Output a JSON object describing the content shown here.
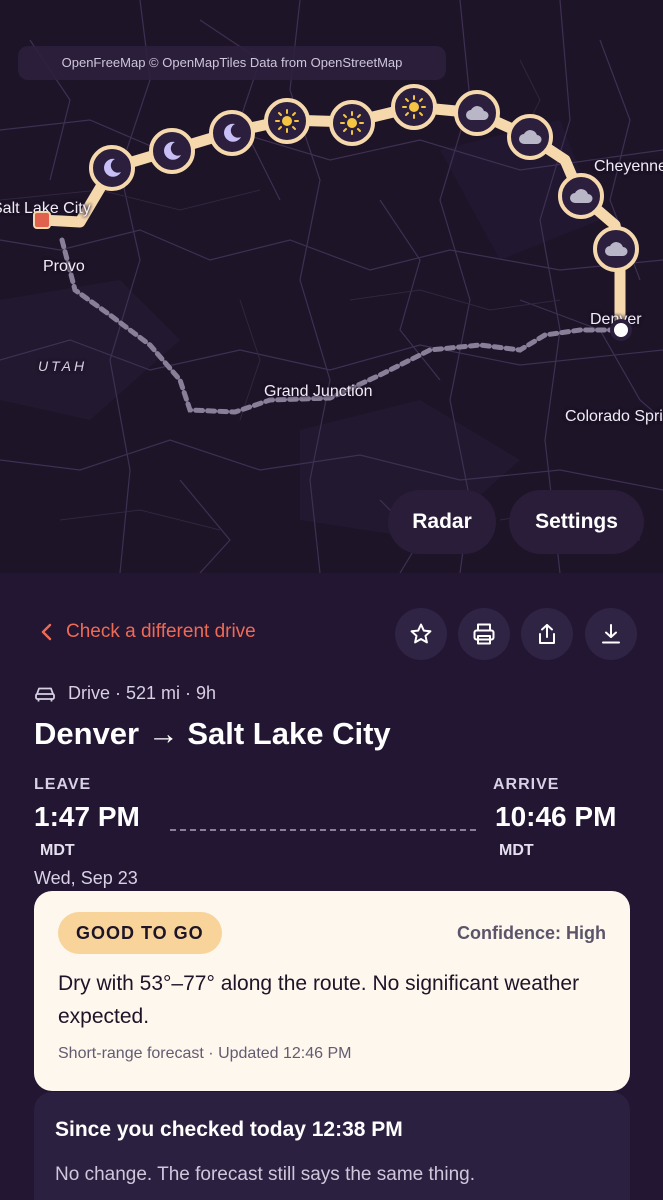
{
  "map": {
    "attribution": "OpenFreeMap © OpenMapTiles Data from OpenStreetMap",
    "places": {
      "salt_lake_city": "Salt Lake City",
      "provo": "Provo",
      "utah": "UTAH",
      "grand_junction": "Grand Junction",
      "cheyenne": "Cheyenne",
      "denver": "Denver",
      "colorado_springs": "Colorado Springs"
    },
    "weather_markers": [
      "moon",
      "moon",
      "moon",
      "sun",
      "sun",
      "sun",
      "cloud",
      "cloud",
      "cloud",
      "cloud"
    ],
    "buttons": {
      "radar": "Radar",
      "settings": "Settings"
    }
  },
  "panel": {
    "back_label": "Check a different drive",
    "actions": [
      "star-icon",
      "print-icon",
      "share-icon",
      "download-icon"
    ],
    "meta": "Drive · 521 mi · 9h",
    "title": "Denver → Salt Lake City",
    "leave": {
      "label": "LEAVE",
      "time": "1:47 PM",
      "tz": "MDT",
      "date": "Wed, Sep 23"
    },
    "arrive": {
      "label": "ARRIVE",
      "time": "10:46 PM",
      "tz": "MDT"
    },
    "status": {
      "badge": "GOOD TO GO",
      "confidence": "Confidence: High",
      "summary": "Dry with 53°–77° along the route. No significant weather expected.",
      "updated": "Short-range forecast · Updated 12:46 PM"
    },
    "since": {
      "title": "Since you checked today 12:38 PM",
      "body": "No change. The forecast still says the same thing."
    }
  },
  "colors": {
    "accent": "#ef6a55",
    "route": "#f6d8ad",
    "badge": "#f8d49b",
    "background": "#221633"
  }
}
